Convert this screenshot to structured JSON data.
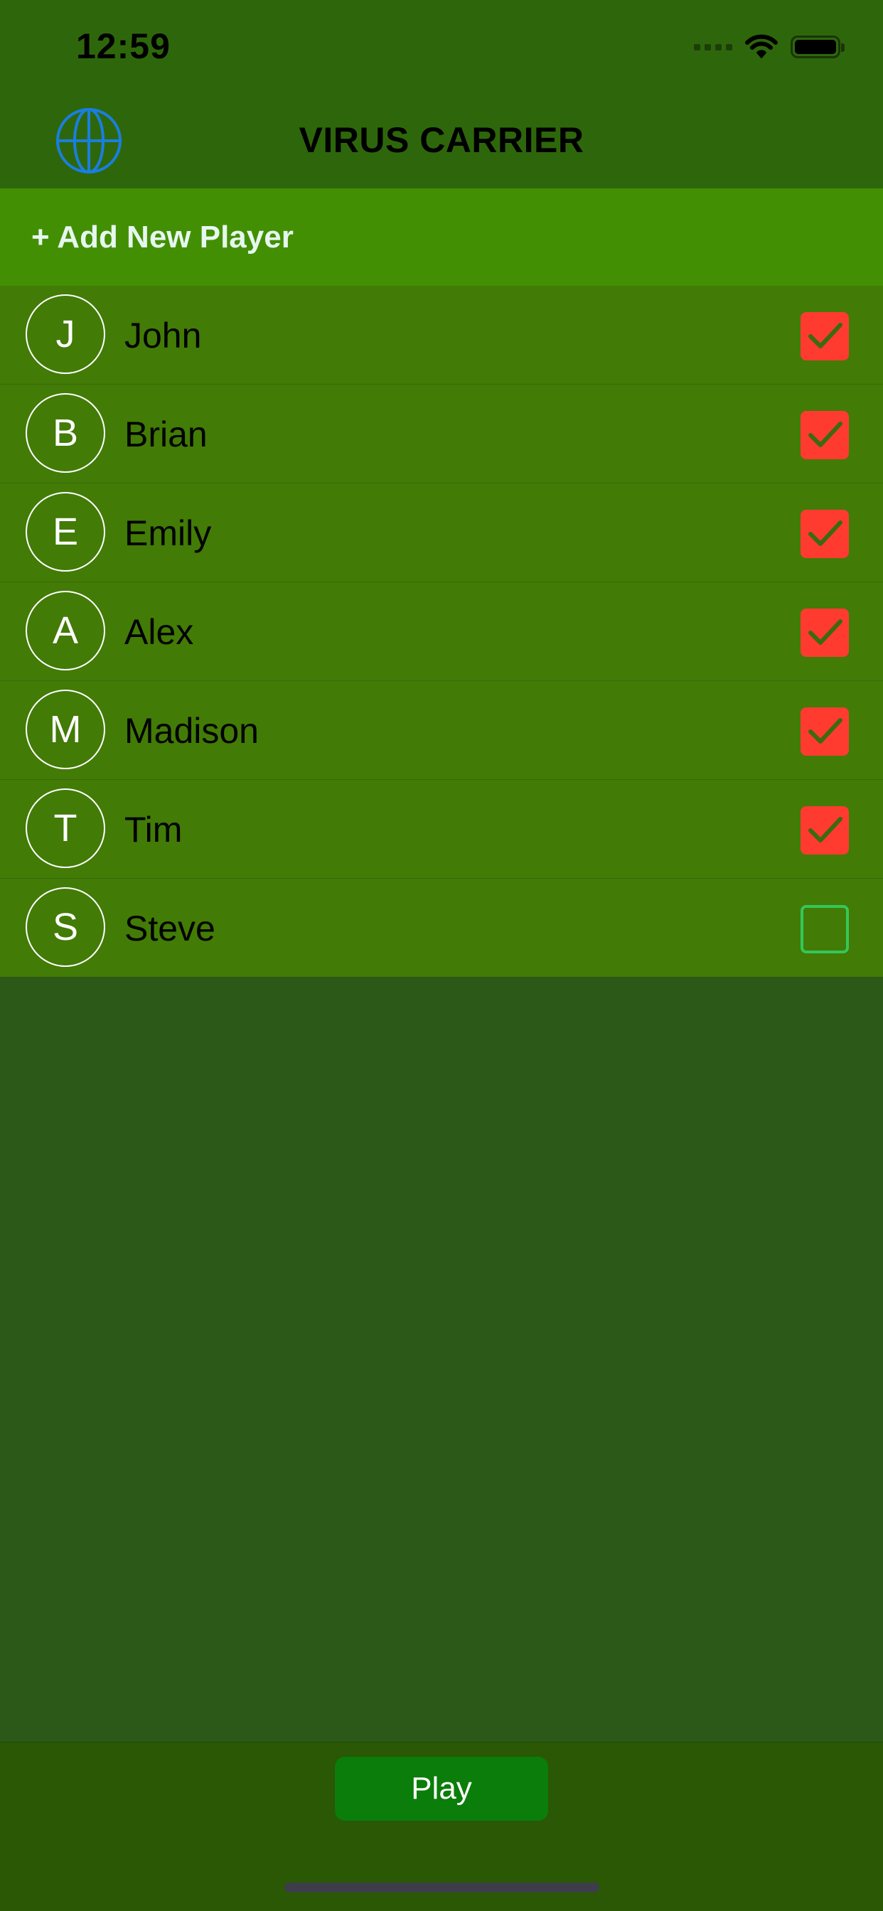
{
  "status_bar": {
    "time": "12:59"
  },
  "nav": {
    "title": "VIRUS CARRIER",
    "left_icon": "globe-icon"
  },
  "add_player": {
    "label": "+ Add New Player"
  },
  "players": [
    {
      "initial": "J",
      "name": "John",
      "selected": true
    },
    {
      "initial": "B",
      "name": "Brian",
      "selected": true
    },
    {
      "initial": "E",
      "name": "Emily",
      "selected": true
    },
    {
      "initial": "A",
      "name": "Alex",
      "selected": true
    },
    {
      "initial": "M",
      "name": "Madison",
      "selected": true
    },
    {
      "initial": "T",
      "name": "Tim",
      "selected": true
    },
    {
      "initial": "S",
      "name": "Steve",
      "selected": false
    }
  ],
  "footer": {
    "play_label": "Play"
  },
  "colors": {
    "header_bg": "#2e670b",
    "add_row_bg": "#438f04",
    "list_bg": "#427b06",
    "body_bg": "#2c5917",
    "footer_bg": "#2a5805",
    "checked": "#ff3b30",
    "unchecked_border": "#34c759",
    "play_button": "#0a7d0a",
    "globe_icon": "#1a7ee0"
  }
}
